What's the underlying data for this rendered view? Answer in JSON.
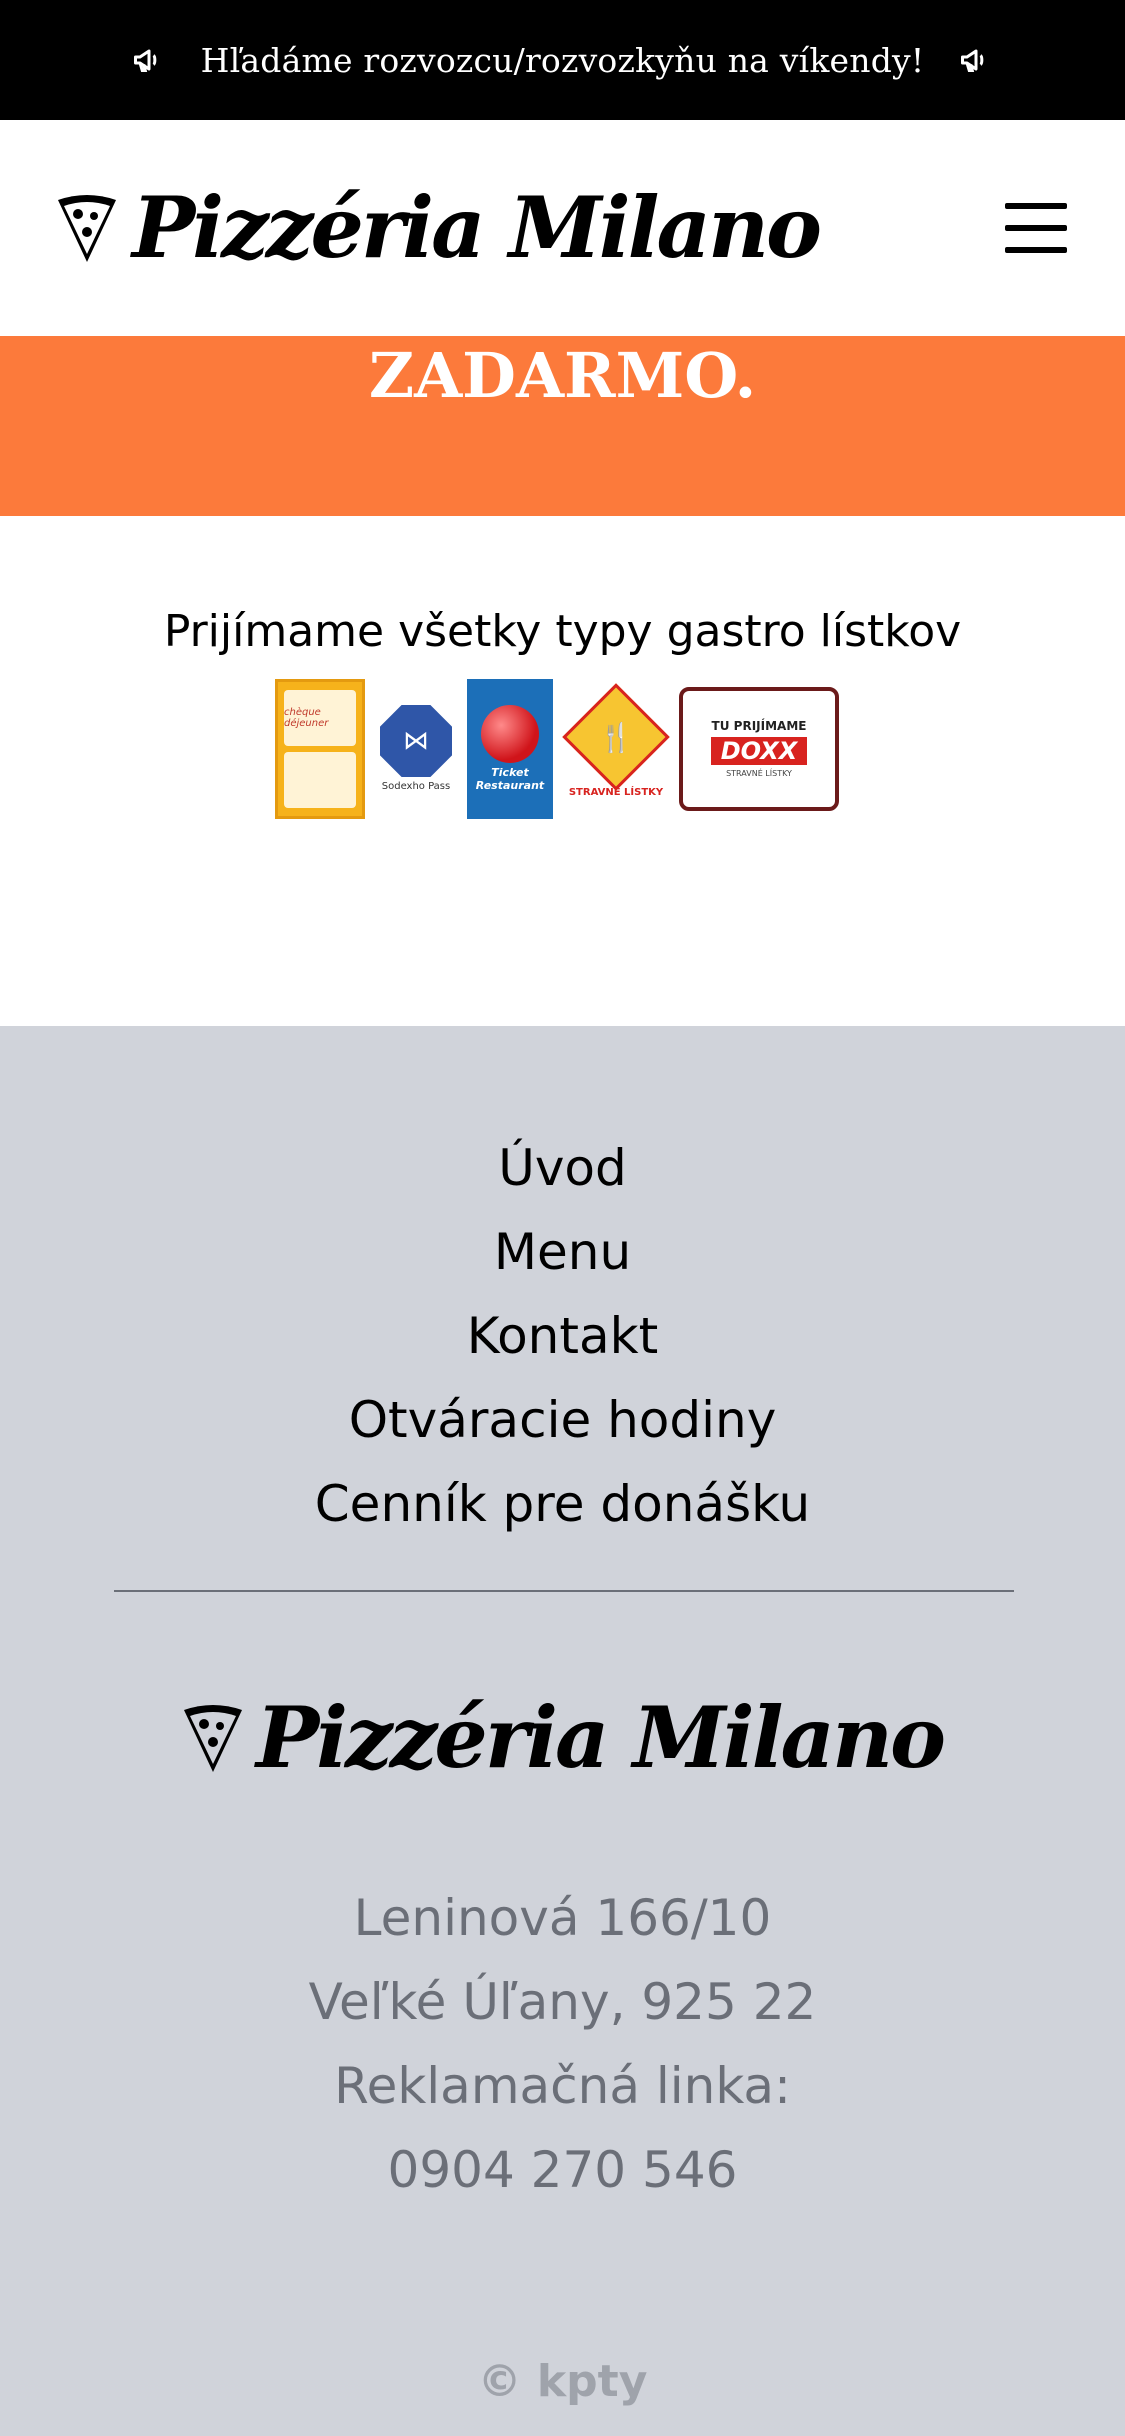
{
  "announcement": {
    "text": "Hľadáme rozvozcu/rozvozkyňu na víkendy!"
  },
  "header": {
    "logo_text": "Pizzéria Milano"
  },
  "promo": {
    "text": "ZADARMO."
  },
  "vouchers": {
    "title": "Prijímame všetky typy gastro lístkov",
    "logos": [
      {
        "name": "cheque-dejeuner-logo",
        "label": "chèque déjeuner"
      },
      {
        "name": "sodexho-logo",
        "label": "Sodexho Pass"
      },
      {
        "name": "ticket-restaurant-logo",
        "label": "Ticket Restaurant"
      },
      {
        "name": "stravne-listky-logo",
        "label": "STRAVNÉ LÍSTKY"
      },
      {
        "name": "doxx-logo",
        "top": "TU PRIJÍMAME",
        "brand": "DOXX",
        "label": "STRAVNÉ LÍSTKY"
      }
    ]
  },
  "footer": {
    "nav": [
      "Úvod",
      "Menu",
      "Kontakt",
      "Otváracie hodiny",
      "Cenník pre donášku"
    ],
    "logo_text": "Pizzéria Milano",
    "address": [
      "Leninová 166/10",
      "Veľké Úľany, 925 22",
      "Reklamačná linka:",
      "0904 270 546"
    ],
    "copyright": "© kpty"
  },
  "colors": {
    "accent": "#fc7a3b",
    "footer_bg": "#d0d3da",
    "muted_text": "#6b6f78"
  }
}
